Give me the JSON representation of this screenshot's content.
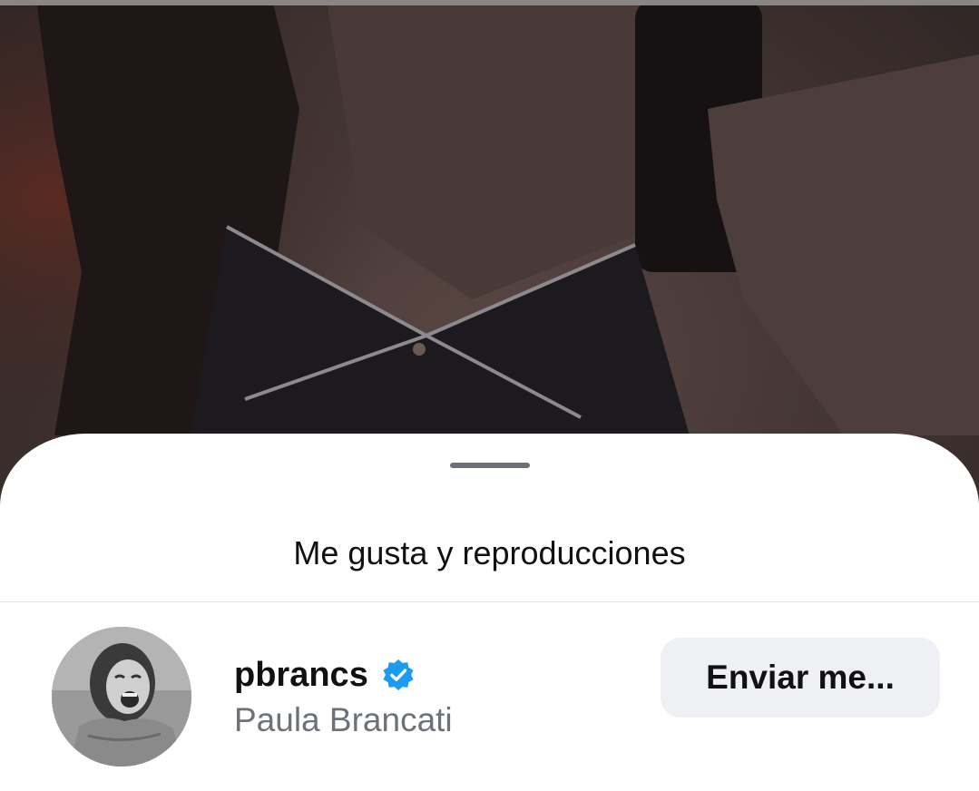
{
  "sheet": {
    "title": "Me gusta y reproducciones"
  },
  "likers": [
    {
      "username": "pbrancs",
      "full_name": "Paula Brancati",
      "verified": true,
      "action_label": "Enviar me..."
    }
  ],
  "colors": {
    "verified_badge": "#1d9bf0",
    "button_bg": "#eff0f4",
    "secondary_text": "#6d7279"
  }
}
